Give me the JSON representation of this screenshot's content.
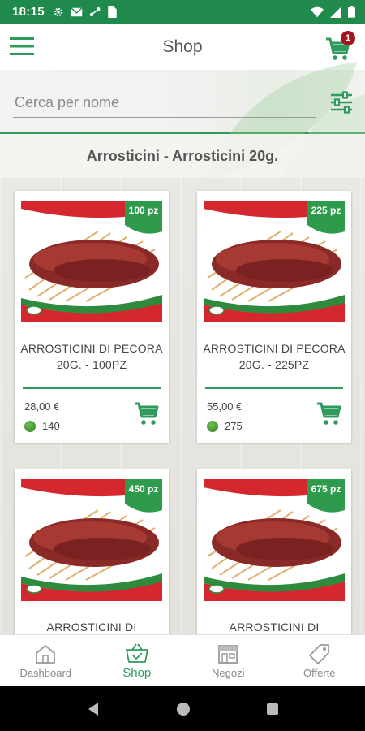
{
  "status_bar": {
    "time": "18:15",
    "icons": [
      "settings-icon",
      "mail-icon",
      "data-saver-icon",
      "sim-card-icon",
      "wifi-icon",
      "signal-icon",
      "battery-icon"
    ]
  },
  "app_bar": {
    "title": "Shop",
    "cart_badge": "1",
    "icons": [
      "hamburger-menu-icon",
      "shopping-cart-icon"
    ]
  },
  "search": {
    "placeholder": "Cerca per nome",
    "value": ""
  },
  "category": {
    "title": "Arrosticini - Arrosticini 20g."
  },
  "products": [
    {
      "name": "ARROSTICINI DI PECORA 20G. - 100PZ",
      "price": "28,00 €",
      "points": "140",
      "tag": "100 pz"
    },
    {
      "name": "ARROSTICINI DI PECORA 20G. - 225PZ",
      "price": "55,00 €",
      "points": "275",
      "tag": "225 pz"
    },
    {
      "name": "ARROSTICINI DI",
      "price": "",
      "points": "",
      "tag": "450 pz"
    },
    {
      "name": "ARROSTICINI DI",
      "price": "",
      "points": "",
      "tag": "675 pz"
    }
  ],
  "bottom_nav": [
    {
      "label": "Dashboard",
      "icon": "home-icon",
      "active": false
    },
    {
      "label": "Shop",
      "icon": "basket-icon",
      "active": true
    },
    {
      "label": "Negozi",
      "icon": "store-icon",
      "active": false
    },
    {
      "label": "Offerte",
      "icon": "tag-icon",
      "active": false
    }
  ],
  "colors": {
    "primary_green": "#2e9a5c",
    "status_bar_green": "#1f8a4c",
    "badge_red": "#a31621"
  }
}
